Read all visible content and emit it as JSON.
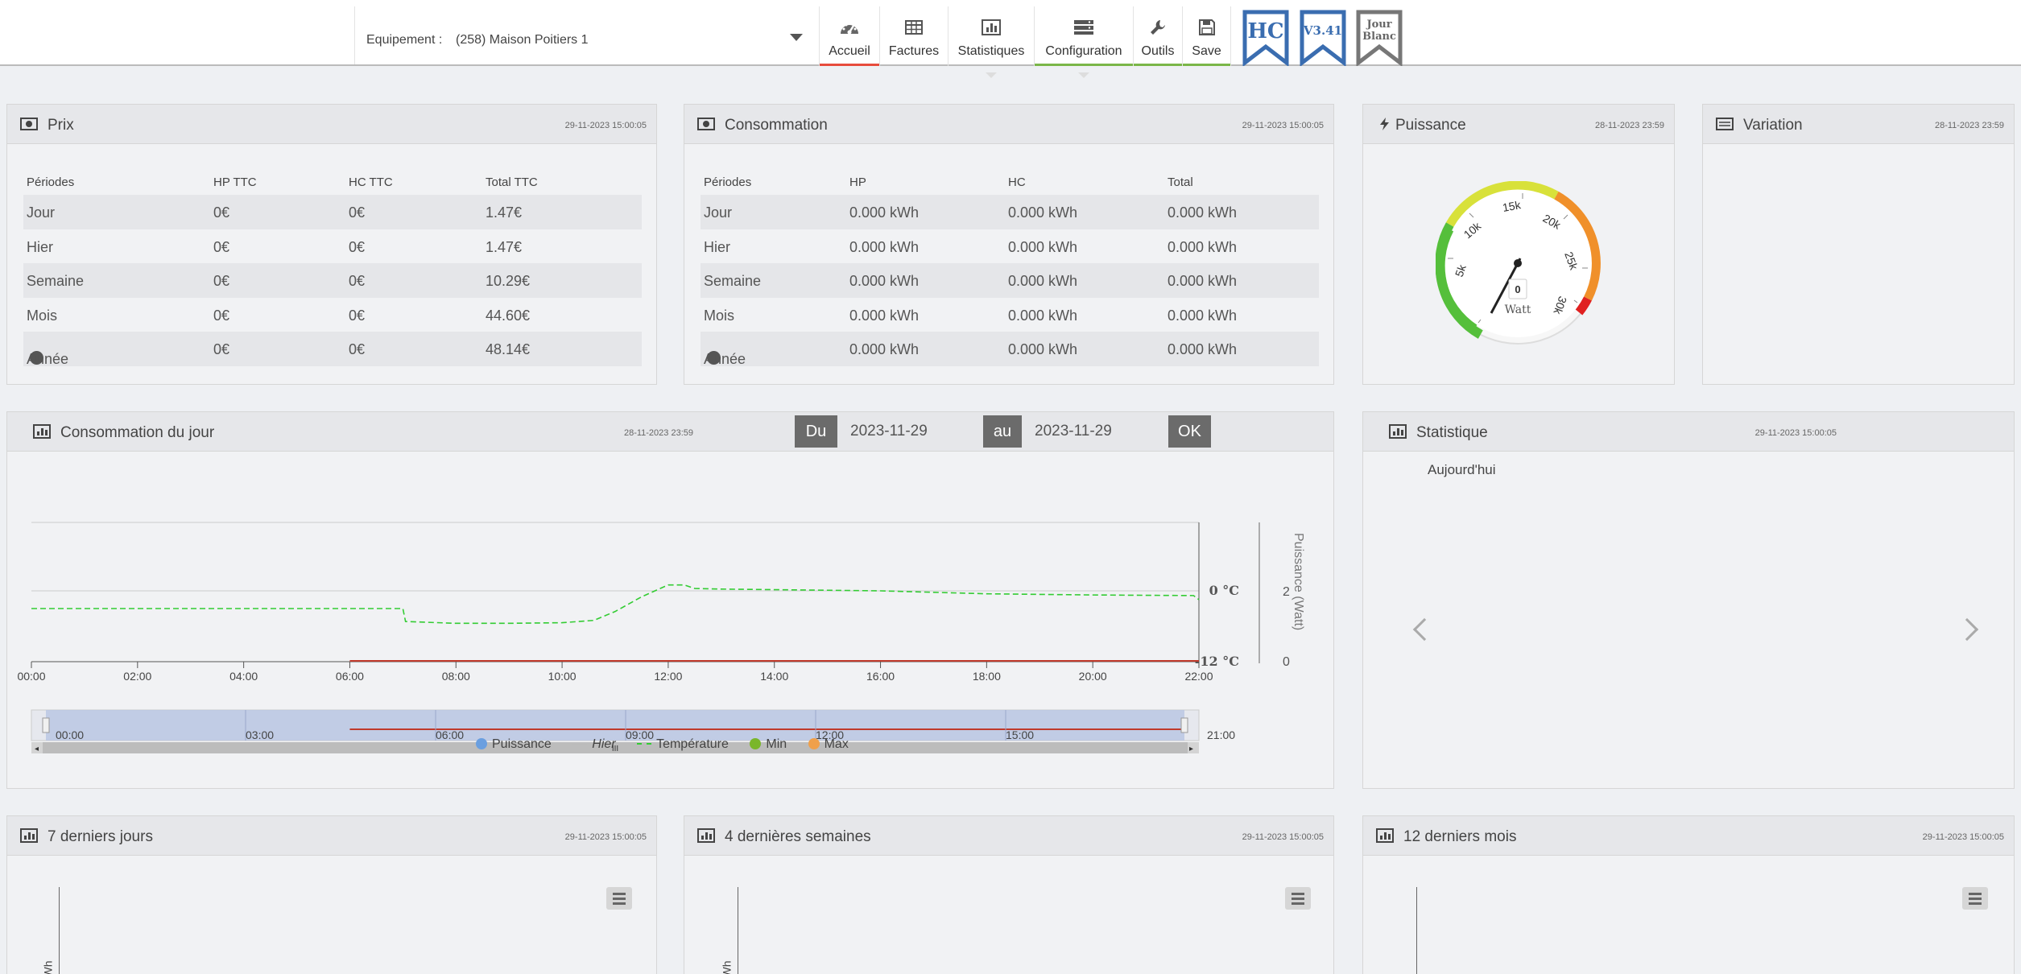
{
  "header": {
    "equipment_label": "Equipement :",
    "equipment_value": "(258) Maison Poitiers 1",
    "nav": [
      {
        "label": "Accueil",
        "icon": "dashboard-icon",
        "underline": "#e74c3c"
      },
      {
        "label": "Factures",
        "icon": "table-icon",
        "underline": ""
      },
      {
        "label": "Statistiques",
        "icon": "bar-chart-icon",
        "underline": ""
      },
      {
        "label": "Configuration",
        "icon": "server-icon",
        "underline": "#7ab648"
      },
      {
        "label": "Outils",
        "icon": "wrench-icon",
        "underline": "#7ab648"
      },
      {
        "label": "Save",
        "icon": "floppy-icon",
        "underline": "#7ab648"
      }
    ],
    "badges": [
      {
        "text": "HC",
        "color": "#3a6db0"
      },
      {
        "text": "V3.41",
        "color": "#3a6db0"
      },
      {
        "text_line1": "Jour",
        "text_line2": "Blanc",
        "color": "#777777"
      }
    ]
  },
  "prix": {
    "title": "Prix",
    "date": "29-11-2023 15:00:05",
    "headers": [
      "Périodes",
      "HP TTC",
      "HC TTC",
      "Total TTC"
    ],
    "rows": [
      [
        "Jour",
        "0€",
        "0€",
        "1.47€"
      ],
      [
        "Hier",
        "0€",
        "0€",
        "1.47€"
      ],
      [
        "Semaine",
        "0€",
        "0€",
        "10.29€"
      ],
      [
        "Mois",
        "0€",
        "0€",
        "44.60€"
      ],
      [
        "Année",
        "0€",
        "0€",
        "48.14€"
      ]
    ]
  },
  "consommation": {
    "title": "Consommation",
    "date": "29-11-2023 15:00:05",
    "headers": [
      "Périodes",
      "HP",
      "HC",
      "Total"
    ],
    "rows": [
      [
        "Jour",
        "0.000 kWh",
        "0.000 kWh",
        "0.000 kWh"
      ],
      [
        "Hier",
        "0.000 kWh",
        "0.000 kWh",
        "0.000 kWh"
      ],
      [
        "Semaine",
        "0.000 kWh",
        "0.000 kWh",
        "0.000 kWh"
      ],
      [
        "Mois",
        "0.000 kWh",
        "0.000 kWh",
        "0.000 kWh"
      ],
      [
        "Année",
        "0.000 kWh",
        "0.000 kWh",
        "0.000 kWh"
      ]
    ]
  },
  "puissance": {
    "title": "Puissance",
    "date": "28-11-2023 23:59",
    "gauge_value": "0",
    "gauge_unit": "Watt",
    "gauge_ticks": [
      "5k",
      "10k",
      "15k",
      "20k",
      "25k",
      "30k"
    ]
  },
  "variation": {
    "title": "Variation",
    "date": "28-11-2023 23:59"
  },
  "conso_jour": {
    "title": "Consommation du jour",
    "date": "28-11-2023 23:59",
    "du_label": "Du",
    "du_value": "2023-11-29",
    "au_label": "au",
    "au_value": "2023-11-29",
    "ok_label": "OK",
    "right_axis_title": "Puissance (Watt)",
    "temp_labels": [
      "0 °C",
      "-12 °C"
    ],
    "power_labels": [
      "2",
      "0"
    ],
    "navigator_ticks": [
      "00:00",
      "03:00",
      "06:00",
      "09:00",
      "12:00",
      "15:00",
      "21:00"
    ],
    "legend": [
      {
        "label": "Puissance",
        "color": "#6a9fe0"
      },
      {
        "label": "Hier",
        "color": "#bbbbbb"
      },
      {
        "label": "Température",
        "color": "#33cc33"
      },
      {
        "label": "Min",
        "color": "#7ab62a"
      },
      {
        "label": "Max",
        "color": "#f0a04b"
      }
    ]
  },
  "chart_data": {
    "type": "line",
    "x_ticks": [
      "00:00",
      "02:00",
      "04:00",
      "06:00",
      "08:00",
      "10:00",
      "12:00",
      "14:00",
      "16:00",
      "18:00",
      "20:00",
      "22:00"
    ],
    "series": [
      {
        "name": "Température",
        "axis": "temperature",
        "x": [
          0,
          2,
          4,
          6,
          7,
          7.05,
          8,
          9,
          10,
          10.6,
          11,
          11.5,
          12,
          12.3,
          12.5,
          13,
          14,
          16,
          18,
          20,
          21.9,
          22
        ],
        "values": [
          -3,
          -3,
          -3,
          -3,
          -3,
          -5.2,
          -5.5,
          -5.5,
          -5.4,
          -5,
          -3.5,
          -1,
          1,
          1,
          0.4,
          0.3,
          0.2,
          0,
          -0.5,
          -0.7,
          -0.8,
          -1.5
        ]
      },
      {
        "name": "Puissance",
        "axis": "power",
        "x": [
          6,
          22
        ],
        "values": [
          0,
          0
        ]
      }
    ],
    "temperature_range": [
      -12,
      0
    ],
    "power_range": [
      0,
      2
    ],
    "x_range": [
      0,
      22
    ],
    "grid": true
  },
  "statistique": {
    "title": "Statistique",
    "date": "29-11-2023 15:00:05",
    "subtitle": "Aujourd'hui"
  },
  "bottom": [
    {
      "title": "7 derniers jours",
      "date": "29-11-2023 15:00:05",
      "ylabel": "Wh"
    },
    {
      "title": "4 dernières semaines",
      "date": "29-11-2023 15:00:05",
      "ylabel": "Wh"
    },
    {
      "title": "12 derniers mois",
      "date": "29-11-2023 15:00:05",
      "ylabel": ""
    }
  ]
}
